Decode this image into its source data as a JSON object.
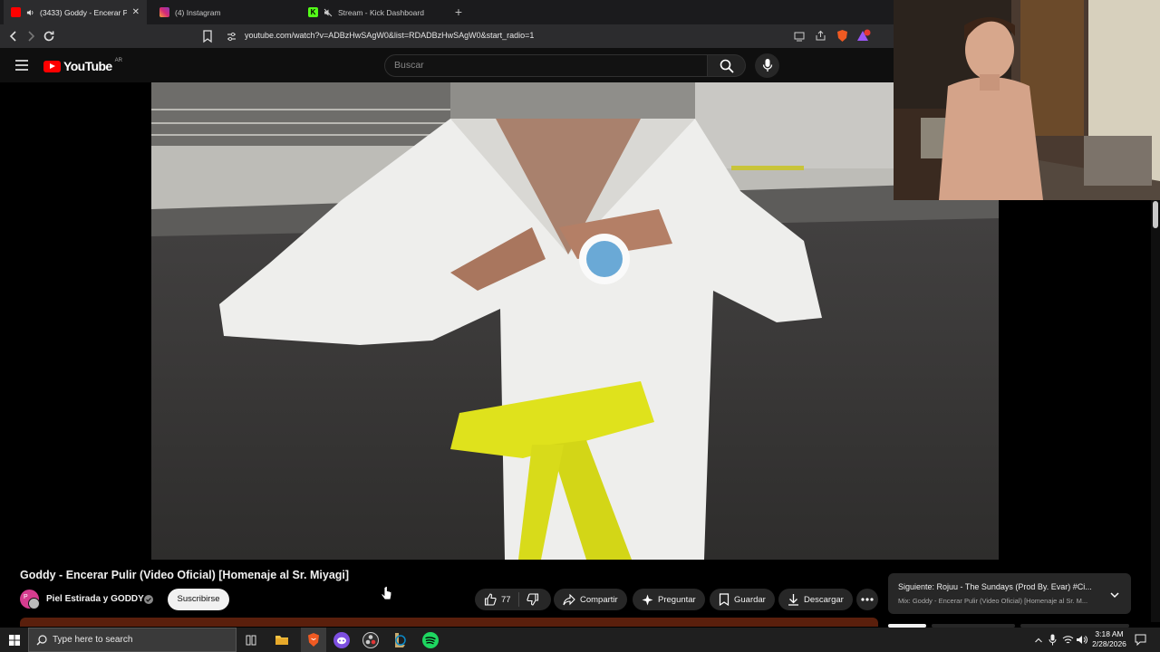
{
  "browser": {
    "tabs": [
      {
        "label": "(3433) Goddy - Encerar Pulir (",
        "active": true
      },
      {
        "label": "(4) Instagram",
        "active": false
      },
      {
        "label": "Stream - Kick Dashboard",
        "active": false
      }
    ],
    "url": "youtube.com/watch?v=ADBzHwSAgW0&list=RDADBzHwSAgW0&start_radio=1"
  },
  "youtube": {
    "logo_text": "YouTube",
    "country_code": "AR",
    "search_placeholder": "Buscar"
  },
  "video": {
    "title": "Goddy - Encerar Pulir (Video Oficial) [Homenaje al Sr. Miyagi]",
    "channel": "Piel Estirada y GODDY",
    "avatar_letter": "P",
    "subscribe_label": "Suscribirse",
    "likes": "77",
    "actions": {
      "share": "Compartir",
      "ask": "Preguntar",
      "save": "Guardar",
      "download": "Descargar"
    }
  },
  "up_next": {
    "title": "Siguiente: Rojuu - The Sundays (Prod By. Evar) #Ci...",
    "subtitle": "Mix: Goddy - Encerar Pulir (Video Oficial) [Homenaje al Sr. M..."
  },
  "taskbar": {
    "search_placeholder": "Type here to search",
    "time": "3:18 AM",
    "date": "2/28/2026"
  },
  "colors": {
    "youtube_red": "#ff0000",
    "subscribe_bg": "#f1f1f1",
    "belt_yellow": "#dfe21c"
  }
}
